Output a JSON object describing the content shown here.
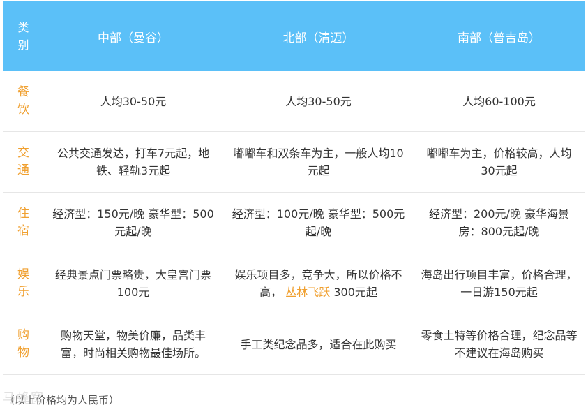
{
  "table": {
    "headers": {
      "category_top": "类",
      "category_bottom": "别",
      "central": "中部（曼谷）",
      "north": "北部（清迈）",
      "south": "南部（普吉岛）"
    },
    "rows": [
      {
        "cat_top": "餐",
        "cat_bottom": "饮",
        "central": "人均30-50元",
        "north": "人均30-50元",
        "south": "人均60-100元"
      },
      {
        "cat_top": "交",
        "cat_bottom": "通",
        "central": "公共交通发达，打车7元起，地铁、轻轨3元起",
        "north": "嘟嘟车和双条车为主，一般人均10元起",
        "south": "嘟嘟车为主，价格较高，人均30元起"
      },
      {
        "cat_top": "住",
        "cat_bottom": "宿",
        "central": "经济型：150元/晚 豪华型：500元起/晚",
        "north": "经济型：100元/晚 豪华型：500元起/晚",
        "south": "经济型：200元/晚 豪华海景房：800元起/晚"
      },
      {
        "cat_top": "娱",
        "cat_bottom": "乐",
        "central": "经典景点门票略贵，大皇宫门票100元",
        "north_before": "娱乐项目多，竞争大，所以价格不高，",
        "north_highlight": "丛林飞跃",
        "north_after": "300元起",
        "south": "海岛出行项目丰富，价格合理，一日游150元起"
      },
      {
        "cat_top": "购",
        "cat_bottom": "物",
        "central": "购物天堂，物美价廉，品类丰富，时尚相关购物最佳场所。",
        "north": "手工类纪念品多，适合在此购买",
        "south": "零食土特等价格合理，纪念品等不建议在海岛购买"
      }
    ]
  },
  "note": "（以上价格均为人民币）",
  "watermark": "马蜂窝",
  "colors": {
    "header_bg": "#5bc0f8",
    "header_text": "#ffffff",
    "category_text": "#f0a030",
    "highlight_link": "#f0a030",
    "row_border": "#e6e6e6"
  }
}
